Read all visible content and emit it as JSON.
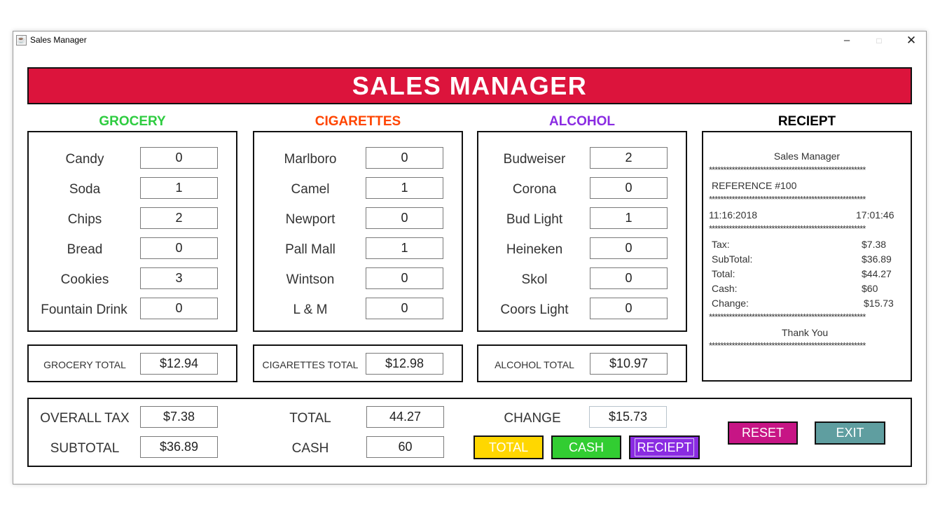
{
  "window": {
    "title": "Sales Manager",
    "icon": "java-coffee-icon",
    "min": "–",
    "max": "□",
    "close": "✕"
  },
  "banner": "SALES MANAGER",
  "colors": {
    "banner": "#dc143c",
    "grocery": "#2ecc40",
    "cigarettes": "#ff4500",
    "alcohol": "#8a2be2",
    "total_btn": "#ffd700",
    "cash_btn": "#32cd32",
    "receipt_btn": "#8a2be2",
    "reset_btn": "#c71585",
    "exit_btn": "#5f9ea0"
  },
  "grocery": {
    "title": "GROCERY",
    "items": [
      {
        "label": "Candy",
        "value": "0"
      },
      {
        "label": "Soda",
        "value": "1"
      },
      {
        "label": "Chips",
        "value": "2"
      },
      {
        "label": "Bread",
        "value": "0"
      },
      {
        "label": "Cookies",
        "value": "3"
      },
      {
        "label": "Fountain Drink",
        "value": "0"
      }
    ],
    "total_label": "GROCERY TOTAL",
    "total_value": "$12.94"
  },
  "cigarettes": {
    "title": "CIGARETTES",
    "items": [
      {
        "label": "Marlboro",
        "value": "0"
      },
      {
        "label": "Camel",
        "value": "1"
      },
      {
        "label": "Newport",
        "value": "0"
      },
      {
        "label": "Pall Mall",
        "value": "1"
      },
      {
        "label": "Wintson",
        "value": "0"
      },
      {
        "label": "L & M",
        "value": "0"
      }
    ],
    "total_label": "CIGARETTES TOTAL",
    "total_value": "$12.98"
  },
  "alcohol": {
    "title": "ALCOHOL",
    "items": [
      {
        "label": "Budweiser",
        "value": "2"
      },
      {
        "label": "Corona",
        "value": "0"
      },
      {
        "label": "Bud Light",
        "value": "1"
      },
      {
        "label": "Heineken",
        "value": "0"
      },
      {
        "label": "Skol",
        "value": "0"
      },
      {
        "label": "Coors Light",
        "value": "0"
      }
    ],
    "total_label": "ALCOHOL TOTAL",
    "total_value": "$10.97"
  },
  "receipt": {
    "title": "RECIEPT",
    "header": "Sales Manager",
    "stars": "*******************************************************",
    "reference": "REFERENCE #100",
    "date": "11:16:2018",
    "time": "17:01:46",
    "tax_label": "Tax:",
    "tax_value": "$7.38",
    "subtotal_label": "SubTotal:",
    "subtotal_value": "$36.89",
    "total_label": "Total:",
    "total_value": "$44.27",
    "cash_label": "Cash:",
    "cash_value": "$60",
    "change_label": "Change:",
    "change_value": "$15.73",
    "footer": "Thank You"
  },
  "summary": {
    "tax_label": "OVERALL TAX",
    "tax_value": "$7.38",
    "subtotal_label": "SUBTOTAL",
    "subtotal_value": "$36.89",
    "total_label": "TOTAL",
    "total_value": "44.27",
    "cash_label": "CASH",
    "cash_value": "60",
    "change_label": "CHANGE",
    "change_value": "$15.73"
  },
  "buttons": {
    "total": "TOTAL",
    "cash": "CASH",
    "receipt": "RECIEPT",
    "reset": "RESET",
    "exit": "EXIT"
  }
}
